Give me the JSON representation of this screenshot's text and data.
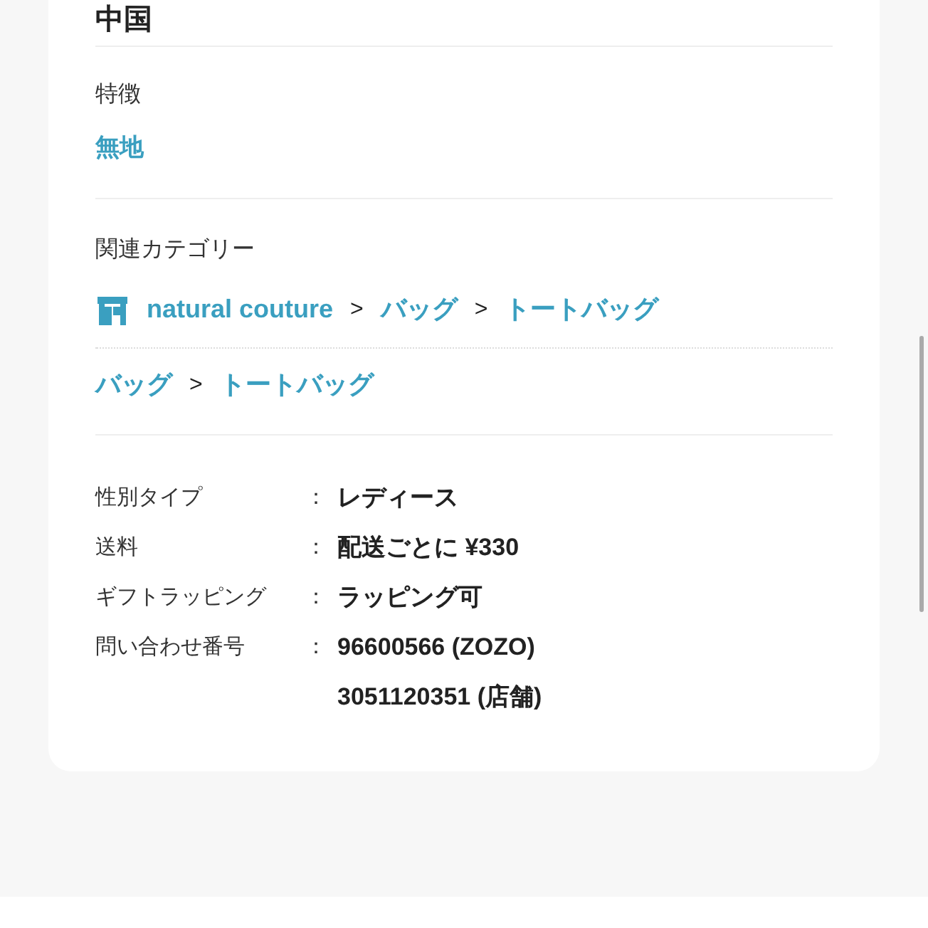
{
  "heading": "中国",
  "feature": {
    "label": "特徴",
    "value": "無地"
  },
  "related_categories": {
    "label": "関連カテゴリー",
    "paths": [
      {
        "kind": "shop",
        "parts": [
          {
            "kind": "link",
            "text": "natural couture"
          },
          {
            "kind": "separator",
            "text": ">"
          },
          {
            "kind": "link",
            "text": "バッグ"
          },
          {
            "kind": "separator",
            "text": ">"
          },
          {
            "kind": "link",
            "text": "トートバッグ"
          }
        ]
      },
      {
        "kind": "plain",
        "parts": [
          {
            "kind": "link",
            "text": "バッグ"
          },
          {
            "kind": "separator",
            "text": ">"
          },
          {
            "kind": "link",
            "text": "トートバッグ"
          }
        ]
      }
    ]
  },
  "details": [
    {
      "label": "性別タイプ",
      "separator": "：",
      "values": [
        "レディース"
      ]
    },
    {
      "label": "送料",
      "separator": "：",
      "values": [
        "配送ごとに ¥330"
      ]
    },
    {
      "label": "ギフトラッピング",
      "separator": "：",
      "values": [
        "ラッピング可"
      ]
    },
    {
      "label": "問い合わせ番号",
      "separator": "：",
      "values": [
        "96600566 (ZOZO)",
        "3051120351 (店舗)"
      ]
    }
  ]
}
